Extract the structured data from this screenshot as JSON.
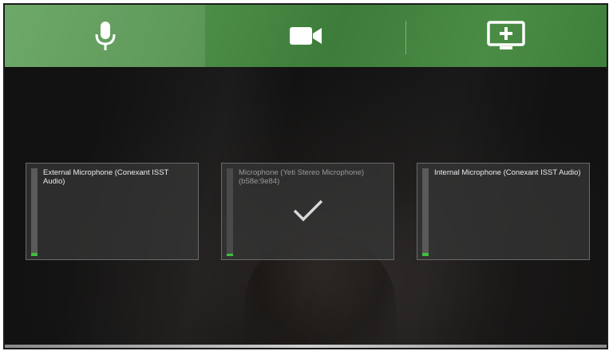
{
  "toolbar": {
    "tabs": [
      {
        "icon": "microphone-icon",
        "active": true
      },
      {
        "icon": "video-camera-icon",
        "active": false
      },
      {
        "icon": "screen-share-icon",
        "active": false
      }
    ]
  },
  "devices": [
    {
      "name": "External Microphone (Conexant ISST Audio)",
      "level": 0.04,
      "selected": false
    },
    {
      "name": "Microphone (Yeti Stereo Microphone) (b58e:9e84)",
      "level": 0.03,
      "selected": true
    },
    {
      "name": "Internal Microphone (Conexant ISST Audio)",
      "level": 0.04,
      "selected": false
    }
  ],
  "colors": {
    "toolbar_green": "#4d8f48",
    "meter_green": "#3fbf3f",
    "card_border": "#6a6a6a"
  }
}
